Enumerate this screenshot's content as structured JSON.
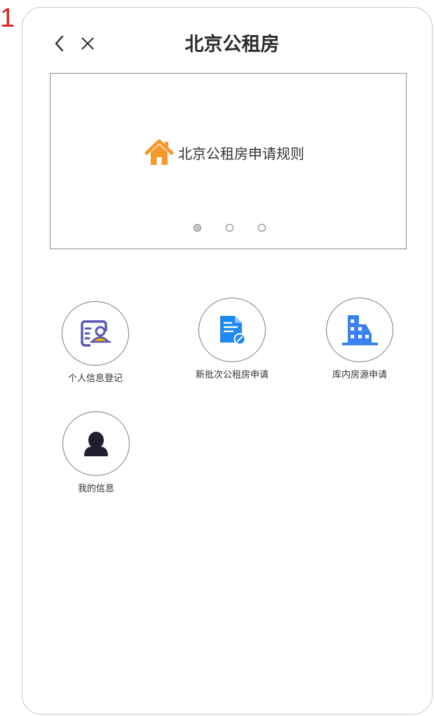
{
  "page_number": "1",
  "header": {
    "title": "北京公租房"
  },
  "banner": {
    "caption": "北京公租房申请规则",
    "dots_total": 3,
    "active_dot": 1
  },
  "menu": {
    "items": [
      {
        "label": "个人信息登记",
        "icon": "personal-info-card-icon"
      },
      {
        "label": "新批次公租房申请",
        "icon": "document-edit-icon"
      },
      {
        "label": "库内房源申请",
        "icon": "building-icon"
      },
      {
        "label": "我的信息",
        "icon": "user-avatar-icon"
      }
    ]
  },
  "colors": {
    "title": "#2c2c2c",
    "house_icon": "#f29a2e",
    "doc_icon": "#1e88f5",
    "building_icon": "#3b82f0",
    "card_icon": "#5a55b8",
    "card_accent": "#f5b400",
    "avatar_icon": "#1e1e30",
    "page_number": "#e02020"
  }
}
